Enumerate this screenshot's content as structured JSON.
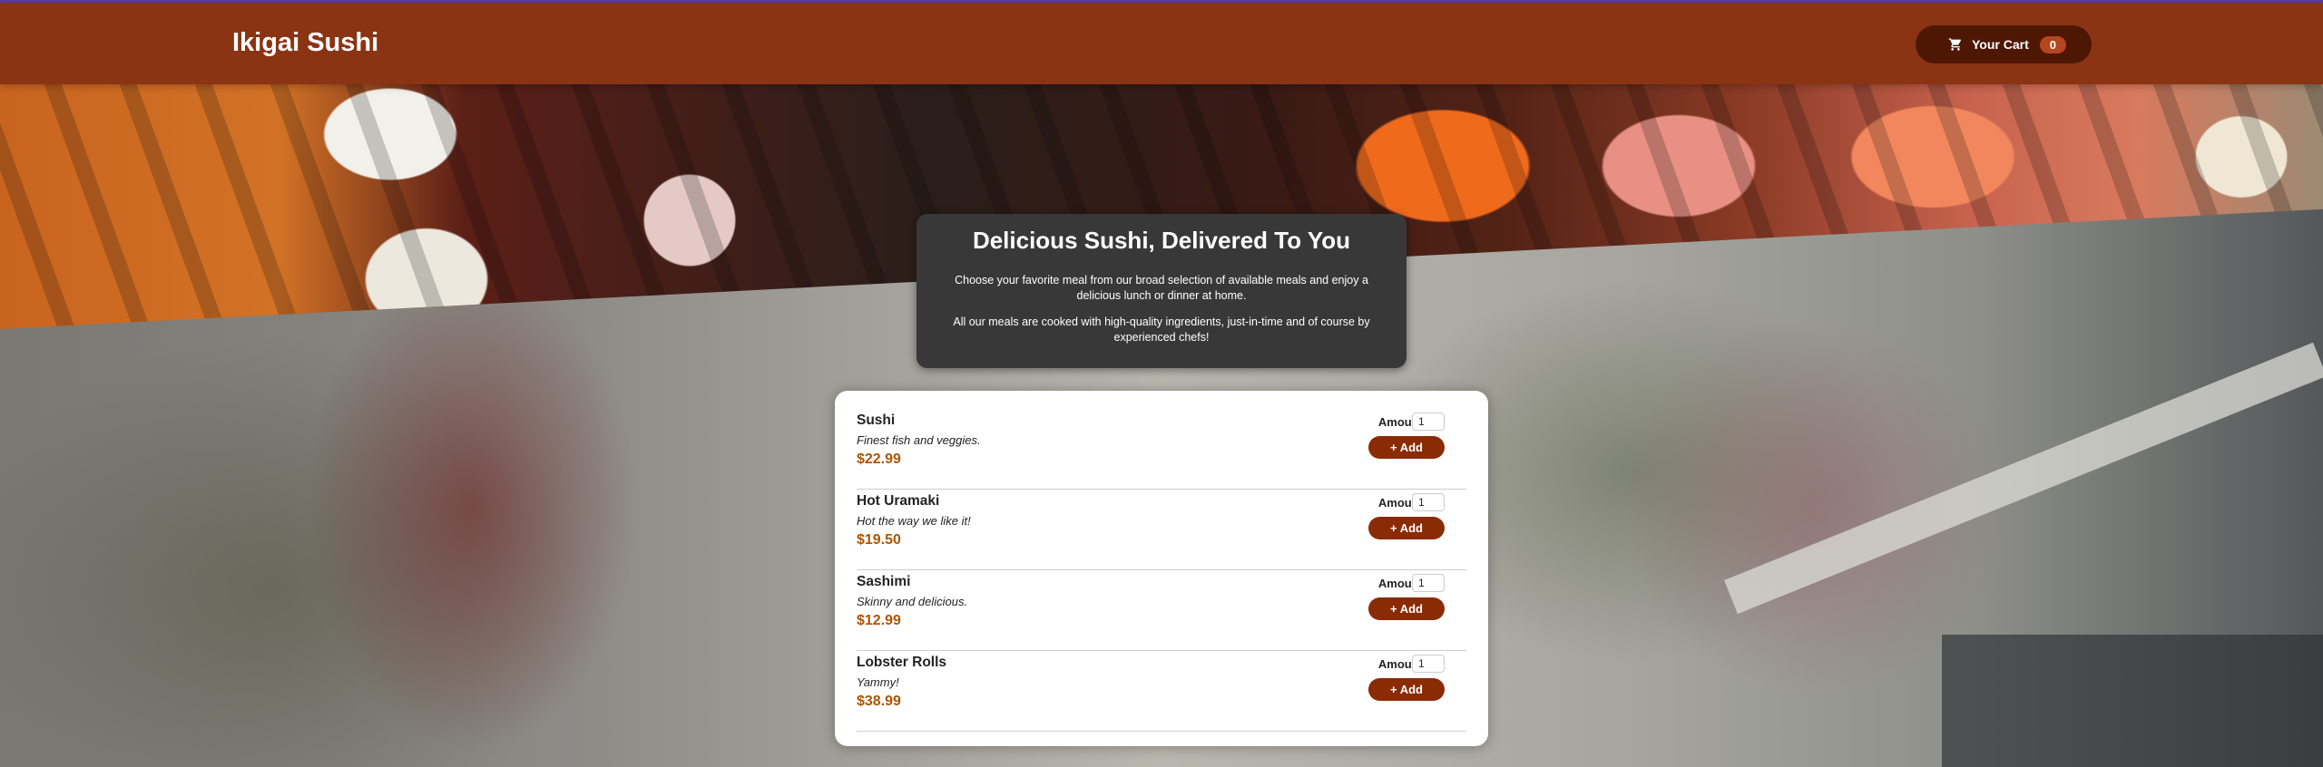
{
  "header": {
    "brand": "Ikigai Sushi",
    "cart_label": "Your Cart",
    "cart_count": "0"
  },
  "summary": {
    "title": "Delicious Sushi, Delivered To You",
    "paragraph1": "Choose your favorite meal from our broad selection of available meals and enjoy a delicious lunch or dinner at home.",
    "paragraph2": "All our meals are cooked with high-quality ingredients, just-in-time and of course by experienced chefs!"
  },
  "meals": [
    {
      "name": "Sushi",
      "description": "Finest fish and veggies.",
      "price": "$22.99",
      "amount_label": "Amount",
      "amount": "1",
      "add_label": "+ Add"
    },
    {
      "name": "Hot Uramaki",
      "description": "Hot the way we like it!",
      "price": "$19.50",
      "amount_label": "Amount",
      "amount": "1",
      "add_label": "+ Add"
    },
    {
      "name": "Sashimi",
      "description": "Skinny and delicious.",
      "price": "$12.99",
      "amount_label": "Amount",
      "amount": "1",
      "add_label": "+ Add"
    },
    {
      "name": "Lobster Rolls",
      "description": "Yammy!",
      "price": "$38.99",
      "amount_label": "Amount",
      "amount": "1",
      "add_label": "+ Add"
    }
  ],
  "icons": {
    "cart": "cart-icon"
  },
  "colors": {
    "header_bg": "#8a3414",
    "cart_button_bg": "#4d1704",
    "badge_bg": "#b5461d",
    "add_button_bg": "#8a2b06",
    "price": "#ad5502",
    "summary_bg": "#383838"
  }
}
